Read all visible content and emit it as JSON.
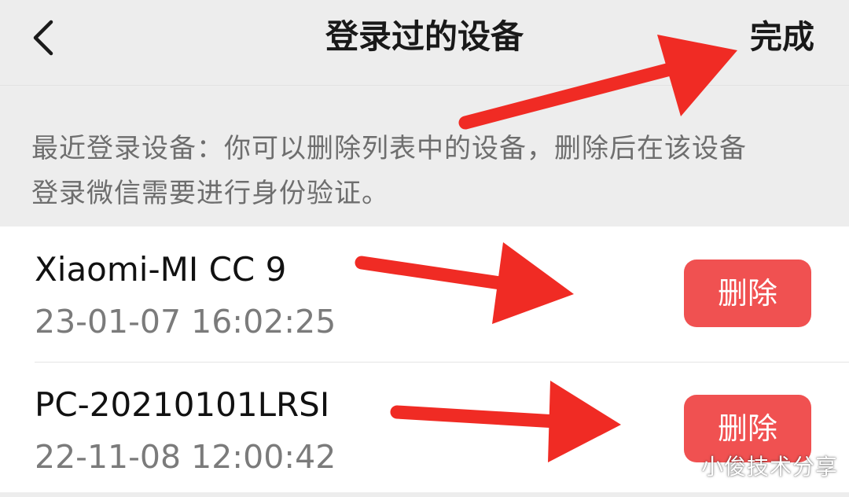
{
  "header": {
    "title": "登录过的设备",
    "done_label": "完成",
    "back_icon": "chevron-left-icon"
  },
  "description": {
    "line1": "最近登录设备：你可以删除列表中的设备，删除后在该设备",
    "line2": "登录微信需要进行身份验证。"
  },
  "devices": [
    {
      "name": "Xiaomi-MI CC 9",
      "time": "23-01-07 16:02:25",
      "delete_label": "删除"
    },
    {
      "name": "PC-20210101LRSI",
      "time": "22-11-08 12:00:42",
      "delete_label": "删除"
    }
  ],
  "colors": {
    "delete_button": "#f05151",
    "annotation_arrow": "#f02b24"
  },
  "watermark": "小俊技术分享"
}
